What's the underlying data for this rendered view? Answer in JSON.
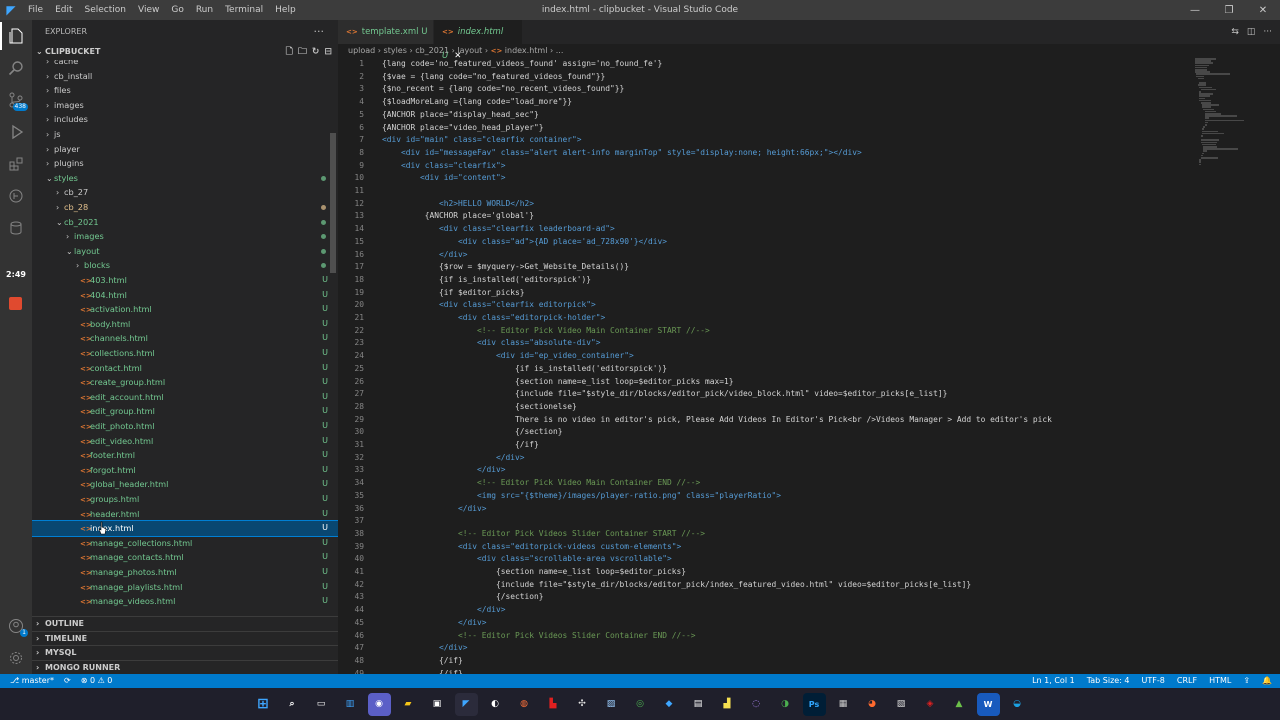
{
  "window": {
    "title": "index.html - clipbucket - Visual Studio Code",
    "menu": [
      "File",
      "Edit",
      "Selection",
      "View",
      "Go",
      "Run",
      "Terminal",
      "Help"
    ]
  },
  "activity": {
    "scm_badge": "438",
    "timer": "2:49",
    "accounts_badge": "1"
  },
  "explorer": {
    "title": "EXPLORER",
    "project": "CLIPBUCKET",
    "tree": [
      {
        "label": "cache",
        "type": "folder",
        "depth": 1,
        "state": "",
        "status": ""
      },
      {
        "label": "cb_install",
        "type": "folder",
        "depth": 1,
        "state": "",
        "status": ""
      },
      {
        "label": "files",
        "type": "folder",
        "depth": 1,
        "state": "",
        "status": ""
      },
      {
        "label": "images",
        "type": "folder",
        "depth": 1,
        "state": "",
        "status": ""
      },
      {
        "label": "includes",
        "type": "folder",
        "depth": 1,
        "state": "",
        "status": ""
      },
      {
        "label": "js",
        "type": "folder",
        "depth": 1,
        "state": "",
        "status": ""
      },
      {
        "label": "player",
        "type": "folder",
        "depth": 1,
        "state": "",
        "status": ""
      },
      {
        "label": "plugins",
        "type": "folder",
        "depth": 1,
        "state": "",
        "status": ""
      },
      {
        "label": "styles",
        "type": "folder-open",
        "depth": 1,
        "state": "untracked",
        "status": "dot"
      },
      {
        "label": "cb_27",
        "type": "folder",
        "depth": 2,
        "state": "",
        "status": ""
      },
      {
        "label": "cb_28",
        "type": "folder",
        "depth": 2,
        "state": "modified",
        "status": "dotmod"
      },
      {
        "label": "cb_2021",
        "type": "folder-open",
        "depth": 2,
        "state": "untracked",
        "status": "dot"
      },
      {
        "label": "images",
        "type": "folder",
        "depth": 3,
        "state": "untracked",
        "status": "dot"
      },
      {
        "label": "layout",
        "type": "folder-open",
        "depth": 3,
        "state": "untracked",
        "status": "dot"
      },
      {
        "label": "blocks",
        "type": "folder",
        "depth": 4,
        "state": "untracked",
        "status": "dot"
      },
      {
        "label": "403.html",
        "type": "file",
        "depth": 4,
        "state": "untracked",
        "status": "U"
      },
      {
        "label": "404.html",
        "type": "file",
        "depth": 4,
        "state": "untracked",
        "status": "U"
      },
      {
        "label": "activation.html",
        "type": "file",
        "depth": 4,
        "state": "untracked",
        "status": "U"
      },
      {
        "label": "body.html",
        "type": "file",
        "depth": 4,
        "state": "untracked",
        "status": "U"
      },
      {
        "label": "channels.html",
        "type": "file",
        "depth": 4,
        "state": "untracked",
        "status": "U"
      },
      {
        "label": "collections.html",
        "type": "file",
        "depth": 4,
        "state": "untracked",
        "status": "U"
      },
      {
        "label": "contact.html",
        "type": "file",
        "depth": 4,
        "state": "untracked",
        "status": "U"
      },
      {
        "label": "create_group.html",
        "type": "file",
        "depth": 4,
        "state": "untracked",
        "status": "U"
      },
      {
        "label": "edit_account.html",
        "type": "file",
        "depth": 4,
        "state": "untracked",
        "status": "U"
      },
      {
        "label": "edit_group.html",
        "type": "file",
        "depth": 4,
        "state": "untracked",
        "status": "U"
      },
      {
        "label": "edit_photo.html",
        "type": "file",
        "depth": 4,
        "state": "untracked",
        "status": "U"
      },
      {
        "label": "edit_video.html",
        "type": "file",
        "depth": 4,
        "state": "untracked",
        "status": "U"
      },
      {
        "label": "footer.html",
        "type": "file",
        "depth": 4,
        "state": "untracked",
        "status": "U"
      },
      {
        "label": "forgot.html",
        "type": "file",
        "depth": 4,
        "state": "untracked",
        "status": "U"
      },
      {
        "label": "global_header.html",
        "type": "file",
        "depth": 4,
        "state": "untracked",
        "status": "U"
      },
      {
        "label": "groups.html",
        "type": "file",
        "depth": 4,
        "state": "untracked",
        "status": "U"
      },
      {
        "label": "header.html",
        "type": "file",
        "depth": 4,
        "state": "untracked",
        "status": "U"
      },
      {
        "label": "index.html",
        "type": "file",
        "depth": 4,
        "state": "selected",
        "status": "U"
      },
      {
        "label": "manage_collections.html",
        "type": "file",
        "depth": 4,
        "state": "untracked",
        "status": "U"
      },
      {
        "label": "manage_contacts.html",
        "type": "file",
        "depth": 4,
        "state": "untracked",
        "status": "U"
      },
      {
        "label": "manage_photos.html",
        "type": "file",
        "depth": 4,
        "state": "untracked",
        "status": "U"
      },
      {
        "label": "manage_playlists.html",
        "type": "file",
        "depth": 4,
        "state": "untracked",
        "status": "U"
      },
      {
        "label": "manage_videos.html",
        "type": "file",
        "depth": 4,
        "state": "untracked",
        "status": "U"
      }
    ],
    "sections": [
      "OUTLINE",
      "TIMELINE",
      "MYSQL",
      "MONGO RUNNER"
    ]
  },
  "tabs": [
    {
      "label": "template.xml",
      "status": "U"
    },
    {
      "label": "index.html",
      "status": "U"
    }
  ],
  "breadcrumb": [
    "upload",
    "styles",
    "cb_2021",
    "layout",
    "index.html",
    "..."
  ],
  "code": [
    {
      "n": "1",
      "t": "{lang code='no_featured_videos_found' assign='no_found_fe'}",
      "k": "tag"
    },
    {
      "n": "2",
      "t": "{$vae = {lang code=\"no_featured_videos_found\"}}",
      "k": "tag"
    },
    {
      "n": "3",
      "t": "{$no_recent = {lang code=\"no_recent_videos_found\"}}",
      "k": "tag"
    },
    {
      "n": "4",
      "t": "{$loadMoreLang ={lang code=\"load_more\"}}",
      "k": "tag"
    },
    {
      "n": "5",
      "t": "{ANCHOR place=\"display_head_sec\"}",
      "k": "tag"
    },
    {
      "n": "6",
      "t": "{ANCHOR place=\"video_head_player\"}",
      "k": "tag"
    },
    {
      "n": "7",
      "t": "<div id=\"main\" class=\"clearfix container\">",
      "k": "html"
    },
    {
      "n": "8",
      "t": "    <div id=\"messageFav\" class=\"alert alert-info marginTop\" style=\"display:none; height:66px;\"></div>",
      "k": "html"
    },
    {
      "n": "9",
      "t": "    <div class=\"clearfix\">",
      "k": "html"
    },
    {
      "n": "10",
      "t": "        <div id=\"content\">",
      "k": "html"
    },
    {
      "n": "11",
      "t": "",
      "k": "tag"
    },
    {
      "n": "12",
      "t": "            <h2>HELLO WORLD</h2>",
      "k": "html"
    },
    {
      "n": "13",
      "t": "         {ANCHOR place='global'}",
      "k": "tag"
    },
    {
      "n": "14",
      "t": "            <div class=\"clearfix leaderboard-ad\">",
      "k": "html"
    },
    {
      "n": "15",
      "t": "                <div class=\"ad\">{AD place='ad_728x90'}</div>",
      "k": "html"
    },
    {
      "n": "16",
      "t": "            </div>",
      "k": "html"
    },
    {
      "n": "17",
      "t": "            {$row = $myquery->Get_Website_Details()}",
      "k": "tag"
    },
    {
      "n": "18",
      "t": "            {if is_installed('editorspick')}",
      "k": "tag"
    },
    {
      "n": "19",
      "t": "            {if $editor_picks}",
      "k": "tag"
    },
    {
      "n": "20",
      "t": "            <div class=\"clearfix editorpick\">",
      "k": "html"
    },
    {
      "n": "21",
      "t": "                <div class=\"editorpick-holder\">",
      "k": "html"
    },
    {
      "n": "22",
      "t": "                    <!-- Editor Pick Video Main Container START //-->",
      "k": "comment"
    },
    {
      "n": "23",
      "t": "                    <div class=\"absolute-div\">",
      "k": "html"
    },
    {
      "n": "24",
      "t": "                        <div id=\"ep_video_container\">",
      "k": "html"
    },
    {
      "n": "25",
      "t": "                            {if is_installed('editorspick')}",
      "k": "tag"
    },
    {
      "n": "26",
      "t": "                            {section name=e_list loop=$editor_picks max=1}",
      "k": "tag"
    },
    {
      "n": "27",
      "t": "                            {include file=\"$style_dir/blocks/editor_pick/video_block.html\" video=$editor_picks[e_list]}",
      "k": "tag"
    },
    {
      "n": "28",
      "t": "                            {sectionelse}",
      "k": "tag"
    },
    {
      "n": "29",
      "t": "                            There is no video in editor's pick, Please Add Videos In Editor's Pick<br />Videos Manager > Add to editor's pick",
      "k": "tag"
    },
    {
      "n": "30",
      "t": "                            {/section}",
      "k": "tag"
    },
    {
      "n": "31",
      "t": "                            {/if}",
      "k": "tag"
    },
    {
      "n": "32",
      "t": "                        </div>",
      "k": "html"
    },
    {
      "n": "33",
      "t": "                    </div>",
      "k": "html"
    },
    {
      "n": "34",
      "t": "                    <!-- Editor Pick Video Main Container END //-->",
      "k": "comment"
    },
    {
      "n": "35",
      "t": "                    <img src=\"{$theme}/images/player-ratio.png\" class=\"playerRatio\">",
      "k": "html"
    },
    {
      "n": "36",
      "t": "                </div>",
      "k": "html"
    },
    {
      "n": "37",
      "t": "",
      "k": "tag"
    },
    {
      "n": "38",
      "t": "                <!-- Editor Pick Videos Slider Container START //-->",
      "k": "comment"
    },
    {
      "n": "39",
      "t": "                <div class=\"editorpick-videos custom-elements\">",
      "k": "html"
    },
    {
      "n": "40",
      "t": "                    <div class=\"scrollable-area vscrollable\">",
      "k": "html"
    },
    {
      "n": "41",
      "t": "                        {section name=e_list loop=$editor_picks}",
      "k": "tag"
    },
    {
      "n": "42",
      "t": "                        {include file=\"$style_dir/blocks/editor_pick/index_featured_video.html\" video=$editor_picks[e_list]}",
      "k": "tag"
    },
    {
      "n": "43",
      "t": "                        {/section}",
      "k": "tag"
    },
    {
      "n": "44",
      "t": "                    </div>",
      "k": "html"
    },
    {
      "n": "45",
      "t": "                </div>",
      "k": "html"
    },
    {
      "n": "46",
      "t": "                <!-- Editor Pick Videos Slider Container END //-->",
      "k": "comment"
    },
    {
      "n": "47",
      "t": "            </div>",
      "k": "html"
    },
    {
      "n": "48",
      "t": "            {/if}",
      "k": "tag"
    },
    {
      "n": "49",
      "t": "            {/if}",
      "k": "tag"
    }
  ],
  "status": {
    "branch": "master*",
    "problems": "0",
    "warnings": "0",
    "position": "Ln 1, Col 1",
    "tabsize": "Tab Size: 4",
    "encoding": "UTF-8",
    "eol": "CRLF",
    "language": "HTML"
  },
  "colors": {
    "accent": "#007acc",
    "untracked": "#73c991",
    "modified": "#e2c08d"
  }
}
